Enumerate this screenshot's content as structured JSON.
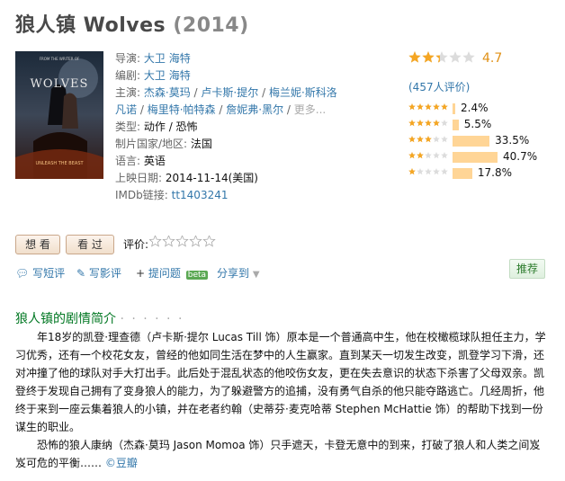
{
  "title": {
    "name": "狼人镇 Wolves",
    "year": "(2014)"
  },
  "poster": {
    "top_text": "FROM THE WRITER OF",
    "film_title": "WOLVES",
    "tagline": "UNLEASH THE BEAST"
  },
  "info": {
    "director_label": "导演:",
    "director": "大卫 海特",
    "writer_label": "编剧:",
    "writer": "大卫 海特",
    "cast_label": "主演:",
    "cast_line1": [
      "杰森·莫玛",
      "卢卡斯·提尔",
      "梅兰妮·斯科洛"
    ],
    "cast_line2": [
      "凡诺",
      "梅里特·帕特森",
      "詹妮弗·黑尔"
    ],
    "cast_more": "更多...",
    "genre_label": "类型:",
    "genre": "动作 / 恐怖",
    "country_label": "制片国家/地区:",
    "country": "法国",
    "language_label": "语言:",
    "language": "英语",
    "release_label": "上映日期:",
    "release": "2014-11-14(美国)",
    "imdb_label": "IMDb链接:",
    "imdb": "tt1403241"
  },
  "rating": {
    "score": "4.7",
    "stars_fraction": 0.47,
    "votes": "(457人评价)",
    "star_color": "#f5a623",
    "empty_star_color": "#dcdcdc"
  },
  "breakdown": [
    {
      "stars": 5,
      "pct_label": "2.4%",
      "pct": 2.4
    },
    {
      "stars": 4,
      "pct_label": "5.5%",
      "pct": 5.5
    },
    {
      "stars": 3,
      "pct_label": "33.5%",
      "pct": 33.5
    },
    {
      "stars": 2,
      "pct_label": "40.7%",
      "pct": 40.7
    },
    {
      "stars": 1,
      "pct_label": "17.8%",
      "pct": 17.8
    }
  ],
  "actions": {
    "want_label": "想 看",
    "seen_label": "看 过",
    "rate_label": "评价:",
    "write_review": "写短评",
    "write_long": "写影评",
    "ask": "提问题",
    "beta": "beta",
    "share": "分享到",
    "recommend": "推荐"
  },
  "summary": {
    "title": "狼人镇的剧情简介",
    "dots": "· · · · · ·",
    "lines_p1": [
      "年18岁的凯登·理查德（卢卡斯·提尔 Lucas Till 饰）原本是一个普通高中生，他在校橄榄球队担任主力，",
      "学习优秀，还有一个校花女友，曾经的他如同生活在梦中的人生赢家。直到某天一切发生改变，凯登学习下滑，",
      "还对冲撞了他的球队对手大打出手。此后处于混乱状态的他咬伤女友，更在失去意识的状态下杀害了父母双亲。",
      "凯登终于发现自己拥有了变身狼人的能力，为了躲避警方的追捕，没有勇气自杀的他只能夺路逃亡。几经周折，",
      "他终于来到一座云集着狼人的小镇，并在老者约翰（史蒂芬·麦克哈蒂 Stephen McHattie 饰）的帮助下找到一份",
      "谋生的职业。"
    ],
    "lines_p2": [
      "恐怖的狼人康纳（杰森·莫玛 Jason Momoa 饰）只手遮天，卡登无意中的到来，打破了狼人和人类之间岌",
      "岌可危的平衡……"
    ],
    "source": "©豆瓣"
  }
}
